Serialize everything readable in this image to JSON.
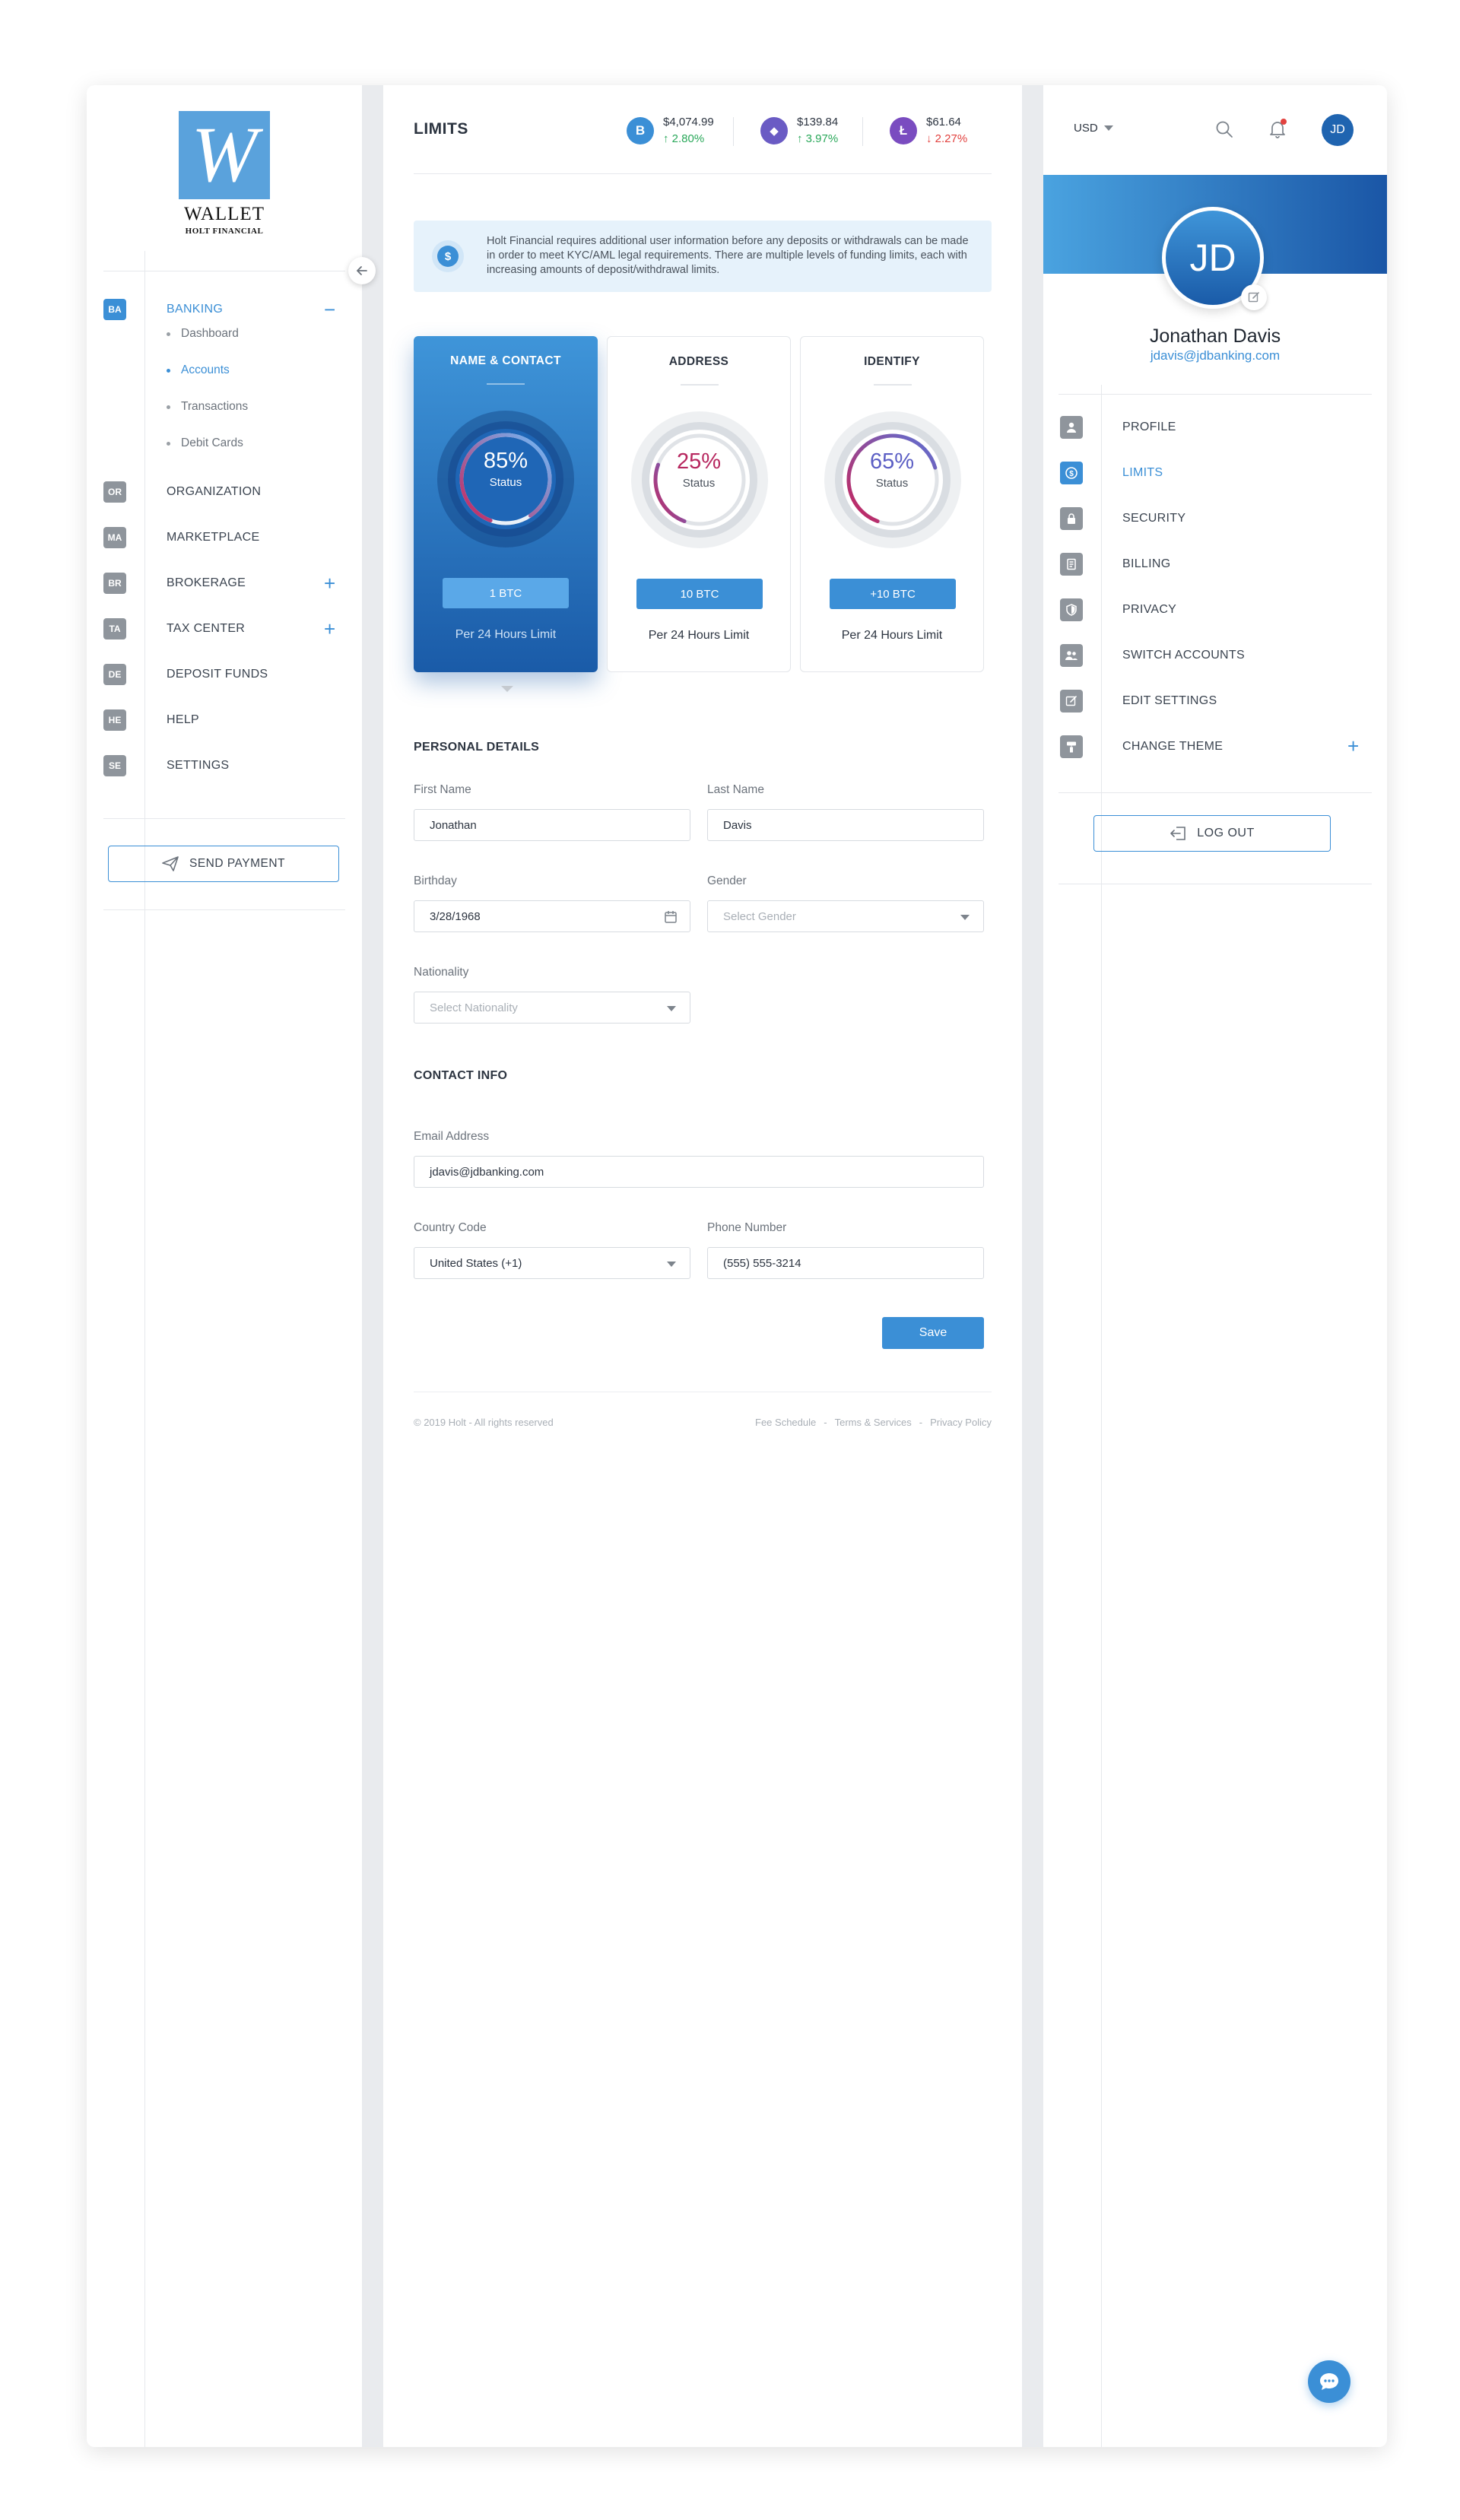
{
  "logo": {
    "letter": "W",
    "name": "WALLET",
    "sub": "HOLT FINANCIAL"
  },
  "nav": {
    "items": [
      {
        "badge": "BA",
        "label": "BANKING",
        "active": true,
        "toggle": "−"
      },
      {
        "badge": "OR",
        "label": "ORGANIZATION"
      },
      {
        "badge": "MA",
        "label": "MARKETPLACE"
      },
      {
        "badge": "BR",
        "label": "BROKERAGE",
        "toggle": "+"
      },
      {
        "badge": "TA",
        "label": "TAX CENTER",
        "toggle": "+"
      },
      {
        "badge": "DE",
        "label": "DEPOSIT FUNDS"
      },
      {
        "badge": "HE",
        "label": "HELP"
      },
      {
        "badge": "SE",
        "label": "SETTINGS"
      }
    ],
    "banking_sub": [
      "Dashboard",
      "Accounts",
      "Transactions",
      "Debit Cards"
    ],
    "active_sub": "Accounts"
  },
  "send_payment": "SEND PAYMENT",
  "header": {
    "title": "LIMITS",
    "tickers": [
      {
        "symbol": "B",
        "price": "$4,074.99",
        "change": "↑ 2.80%",
        "direction": "up",
        "color": "#3b8fd6"
      },
      {
        "symbol": "◆",
        "price": "$139.84",
        "change": "↑ 3.97%",
        "direction": "up",
        "color": "#6a5bc4"
      },
      {
        "symbol": "Ł",
        "price": "$61.64",
        "change": "↓ 2.27%",
        "direction": "down",
        "color": "#7a4cc0"
      }
    ]
  },
  "info": {
    "icon": "$",
    "text": "Holt Financial requires additional user information before any deposits or withdrawals can be made in order to meet KYC/AML legal requirements. There are multiple levels of funding limits, each with increasing amounts of deposit/withdrawal limits."
  },
  "cards": [
    {
      "title": "NAME & CONTACT",
      "percent": "85%",
      "progress": 0.85,
      "status": "Status",
      "button": "1 BTC",
      "footer": "Per 24 Hours Limit",
      "active": true
    },
    {
      "title": "ADDRESS",
      "percent": "25%",
      "progress": 0.25,
      "status": "Status",
      "button": "10 BTC",
      "footer": "Per 24 Hours Limit"
    },
    {
      "title": "IDENTIFY",
      "percent": "65%",
      "progress": 0.65,
      "status": "Status",
      "button": "+10 BTC",
      "footer": "Per 24 Hours Limit"
    }
  ],
  "personal": {
    "title": "PERSONAL DETAILS",
    "first_name_label": "First Name",
    "first_name": "Jonathan",
    "last_name_label": "Last Name",
    "last_name": "Davis",
    "birthday_label": "Birthday",
    "birthday": "3/28/1968",
    "gender_label": "Gender",
    "gender_placeholder": "Select Gender",
    "nationality_label": "Nationality",
    "nationality_placeholder": "Select Nationality"
  },
  "contact": {
    "title": "CONTACT INFO",
    "email_label": "Email Address",
    "email": "jdavis@jdbanking.com",
    "country_label": "Country Code",
    "country": "United States (+1)",
    "phone_label": "Phone Number",
    "phone": "(555) 555-3214"
  },
  "save_label": "Save",
  "footer": {
    "copyright": "© 2019 Holt - All rights reserved",
    "links": [
      "Fee Schedule",
      "-",
      "Terms & Services",
      "-",
      "Privacy Policy"
    ]
  },
  "right": {
    "currency": "USD",
    "initials": "JD",
    "name": "Jonathan Davis",
    "email": "jdavis@jdbanking.com",
    "menu": [
      {
        "icon": "user-icon",
        "label": "PROFILE"
      },
      {
        "icon": "dollar-icon",
        "label": "LIMITS",
        "active": true
      },
      {
        "icon": "lock-icon",
        "label": "SECURITY"
      },
      {
        "icon": "billing-icon",
        "label": "BILLING"
      },
      {
        "icon": "shield-icon",
        "label": "PRIVACY"
      },
      {
        "icon": "users-icon",
        "label": "SWITCH ACCOUNTS"
      },
      {
        "icon": "edit-icon",
        "label": "EDIT SETTINGS"
      },
      {
        "icon": "paint-roller-icon",
        "label": "CHANGE THEME",
        "toggle": "+"
      }
    ],
    "logout": "LOG OUT"
  },
  "colors": {
    "accent": "#3b8fd6",
    "gauge_track": "#e0e3e7",
    "gauge_arc_start": "#c9235a",
    "gauge_arc_end": "#5b72d6",
    "positive": "#2aa85a",
    "negative": "#e2423f"
  }
}
